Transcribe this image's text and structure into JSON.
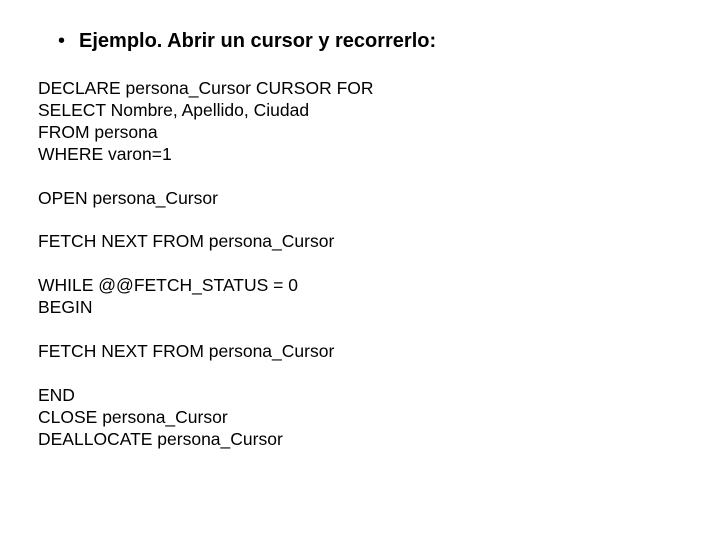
{
  "title": {
    "bullet": "•",
    "text": "Ejemplo. Abrir un cursor y recorrerlo:"
  },
  "code": {
    "line1": "DECLARE persona_Cursor CURSOR FOR",
    "line2": "SELECT Nombre, Apellido, Ciudad",
    "line3": "FROM persona",
    "line4": "WHERE varon=1",
    "line5": "OPEN persona_Cursor",
    "line6": "FETCH NEXT FROM persona_Cursor",
    "line7": "WHILE @@FETCH_STATUS = 0",
    "line8": "BEGIN",
    "line9": "FETCH NEXT FROM persona_Cursor",
    "line10": "END",
    "line11": "CLOSE persona_Cursor",
    "line12": "DEALLOCATE persona_Cursor"
  }
}
